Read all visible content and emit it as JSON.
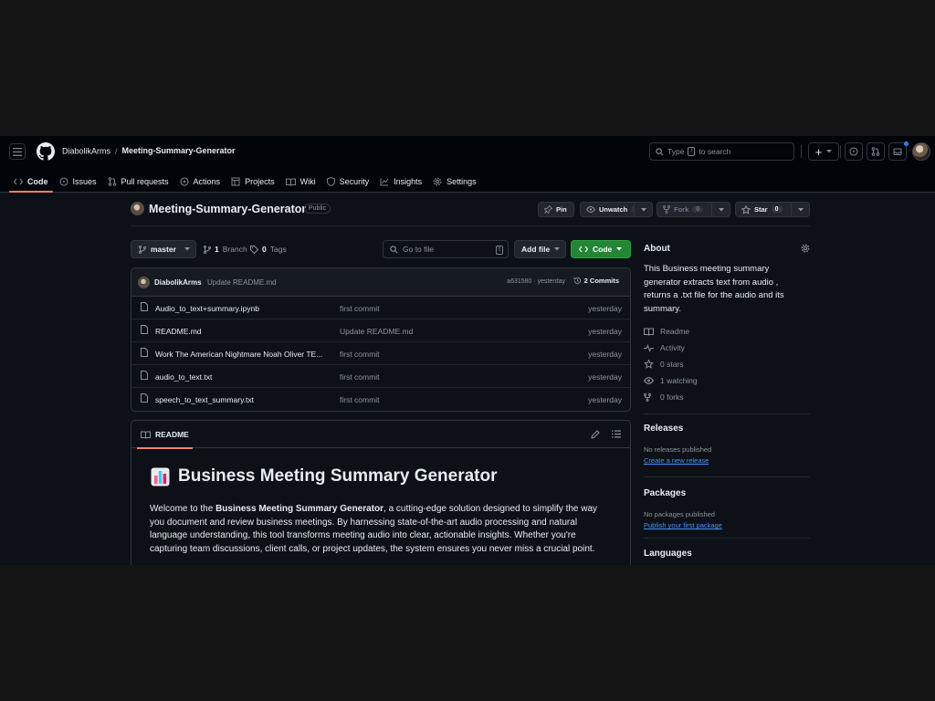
{
  "header": {
    "owner": "DiabolikArms",
    "separator": "/",
    "repo": "Meeting-Summary-Generator",
    "search_prefix": "Type",
    "search_key": "/",
    "search_suffix": "to search",
    "new_label": "+"
  },
  "tabs": [
    {
      "label": "Code",
      "icon": "code-icon",
      "active": true
    },
    {
      "label": "Issues",
      "icon": "issue-icon"
    },
    {
      "label": "Pull requests",
      "icon": "pull-request-icon"
    },
    {
      "label": "Actions",
      "icon": "play-icon"
    },
    {
      "label": "Projects",
      "icon": "table-icon"
    },
    {
      "label": "Wiki",
      "icon": "book-icon"
    },
    {
      "label": "Security",
      "icon": "shield-icon"
    },
    {
      "label": "Insights",
      "icon": "graph-icon"
    },
    {
      "label": "Settings",
      "icon": "gear-icon"
    }
  ],
  "repo": {
    "name": "Meeting-Summary-Generator",
    "visibility": "Public",
    "pin_label": "Pin",
    "watch_label": "Unwatch",
    "watch_count": "1",
    "fork_label": "Fork",
    "fork_count": "0",
    "star_label": "Star",
    "star_count": "0"
  },
  "toolbar": {
    "branch": "master",
    "branch_count": "1",
    "branch_label": "Branch",
    "tag_count": "0",
    "tag_label": "Tags",
    "goto_placeholder": "Go to file",
    "goto_key": "t",
    "add_file": "Add file",
    "code": "Code"
  },
  "commit": {
    "author": "DiabolikArms",
    "message": "Update README.md",
    "hash": "a631580 · yesterday",
    "count": "2 Commits"
  },
  "files": [
    {
      "name": "Audio_to_text+summary.ipynb",
      "commit": "first commit",
      "time": "yesterday"
    },
    {
      "name": "README.md",
      "commit": "Update README.md",
      "time": "yesterday"
    },
    {
      "name": "Work The American Nightmare Noah Oliver TE...",
      "commit": "first commit",
      "time": "yesterday"
    },
    {
      "name": "audio_to_text.txt",
      "commit": "first commit",
      "time": "yesterday"
    },
    {
      "name": "speech_to_text_summary.txt",
      "commit": "first commit",
      "time": "yesterday"
    }
  ],
  "readme": {
    "tab": "README",
    "title": "Business Meeting Summary Generator",
    "p_start": "Welcome to the ",
    "p_bold": "Business Meeting Summary Generator",
    "p_rest": ", a cutting-edge solution designed to simplify the way you document and review business meetings. By harnessing state-of-the-art audio processing and natural language understanding, this tool transforms meeting audio into clear, actionable insights. Whether you're capturing team discussions, client calls, or project updates, the system ensures you never miss a crucial point."
  },
  "about": {
    "title": "About",
    "description": "This Business meeting summary generator extracts text from audio , returns a .txt file for the audio and its summary.",
    "items": [
      {
        "icon": "book-icon",
        "label": "Readme"
      },
      {
        "icon": "pulse-icon",
        "label": "Activity"
      },
      {
        "icon": "star-icon",
        "label": "0 stars"
      },
      {
        "icon": "eye-icon",
        "label": "1 watching"
      },
      {
        "icon": "fork-icon",
        "label": "0 forks"
      }
    ]
  },
  "releases": {
    "title": "Releases",
    "empty": "No releases published",
    "link": "Create a new release"
  },
  "packages": {
    "title": "Packages",
    "empty": "No packages published",
    "link": "Publish your first package"
  },
  "languages": {
    "title": "Languages"
  },
  "colors": {
    "accent_tab": "#f78166",
    "code_button": "#238636",
    "link": "#4493f8"
  }
}
